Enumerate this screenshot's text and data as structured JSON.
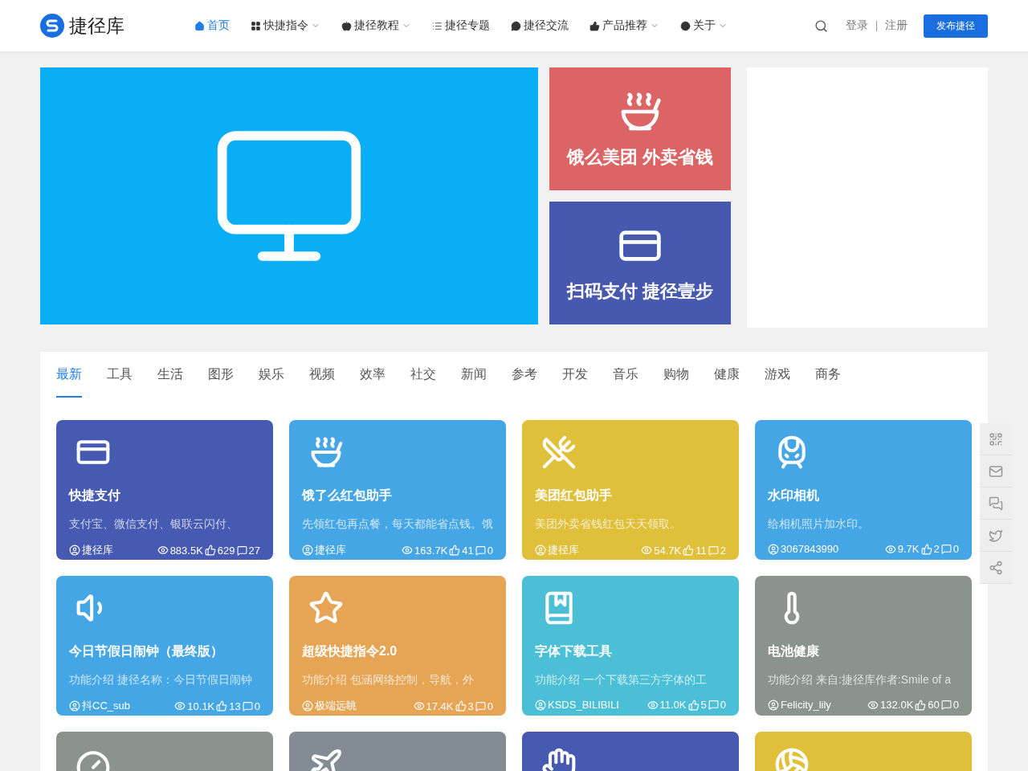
{
  "header": {
    "logo_text": "捷径库",
    "nav": [
      {
        "label": "首页",
        "selected": true,
        "dropdown": false
      },
      {
        "label": "快捷指令",
        "selected": false,
        "dropdown": true
      },
      {
        "label": "捷径教程",
        "selected": false,
        "dropdown": true
      },
      {
        "label": "捷径专题",
        "selected": false,
        "dropdown": false
      },
      {
        "label": "捷径交流",
        "selected": false,
        "dropdown": false
      },
      {
        "label": "产品推荐",
        "selected": false,
        "dropdown": true
      },
      {
        "label": "关于",
        "selected": false,
        "dropdown": true
      }
    ],
    "login": "登录",
    "register": "注册",
    "publish_button": "发布捷径"
  },
  "banner": {
    "side_cards": [
      {
        "title": "饿么美团 外卖省钱",
        "color": "#dc6464"
      },
      {
        "title": "扫码支付 捷径壹步",
        "color": "#4659ae"
      }
    ]
  },
  "tabs": [
    {
      "label": "最新",
      "selected": true
    },
    {
      "label": "工具",
      "selected": false
    },
    {
      "label": "生活",
      "selected": false
    },
    {
      "label": "图形",
      "selected": false
    },
    {
      "label": "娱乐",
      "selected": false
    },
    {
      "label": "视频",
      "selected": false
    },
    {
      "label": "效率",
      "selected": false
    },
    {
      "label": "社交",
      "selected": false
    },
    {
      "label": "新闻",
      "selected": false
    },
    {
      "label": "参考",
      "selected": false
    },
    {
      "label": "开发",
      "selected": false
    },
    {
      "label": "音乐",
      "selected": false
    },
    {
      "label": "购物",
      "selected": false
    },
    {
      "label": "健康",
      "selected": false
    },
    {
      "label": "游戏",
      "selected": false
    },
    {
      "label": "商务",
      "selected": false
    }
  ],
  "cards": [
    {
      "title": "快捷支付",
      "description": "支付宝、微信支付、银联云闪付、",
      "author": "捷径库",
      "views": "883.5K",
      "likes": "629",
      "comments": "27",
      "color": "#465ab2"
    },
    {
      "title": "饿了么红包助手",
      "description": "先领红包再点餐，每天都能省点钱。饿",
      "author": "捷径库",
      "views": "163.7K",
      "likes": "41",
      "comments": "0",
      "color": "#45a6e6"
    },
    {
      "title": "美团红包助手",
      "description": "美团外卖省钱红包天天领取。",
      "author": "捷径库",
      "views": "54.7K",
      "likes": "11",
      "comments": "2",
      "color": "#e0bf3b"
    },
    {
      "title": "水印相机",
      "description": "给相机照片加水印。",
      "author": "3067843990",
      "views": "9.7K",
      "likes": "2",
      "comments": "0",
      "color": "#45a6e6"
    },
    {
      "title": "今日节假日闹钟（最终版）",
      "description": "功能介绍 捷径名称：今日节假日闹钟",
      "author": "抖CC_sub",
      "views": "10.1K",
      "likes": "13",
      "comments": "0",
      "color": "#45a6e6"
    },
    {
      "title": "超级快捷指令2.0",
      "description": "功能介绍 包涵网络控制，导航，外",
      "author": "极端远眺",
      "views": "17.4K",
      "likes": "3",
      "comments": "0",
      "color": "#e6a455"
    },
    {
      "title": "字体下载工具",
      "description": "功能介绍 一个下载第三方字体的工",
      "author": "KSDS_BILIBILI",
      "views": "11.0K",
      "likes": "5",
      "comments": "0",
      "color": "#4bbfd6"
    },
    {
      "title": "电池健康",
      "description": "功能介绍 来自:捷径库作者:Smile of a",
      "author": "Felicity_lily",
      "views": "132.0K",
      "likes": "60",
      "comments": "0",
      "color": "#8b948c"
    },
    {
      "color": "#8b948c"
    },
    {
      "color": "#838b94"
    },
    {
      "color": "#465ab2"
    },
    {
      "color": "#e0bf3b"
    }
  ]
}
